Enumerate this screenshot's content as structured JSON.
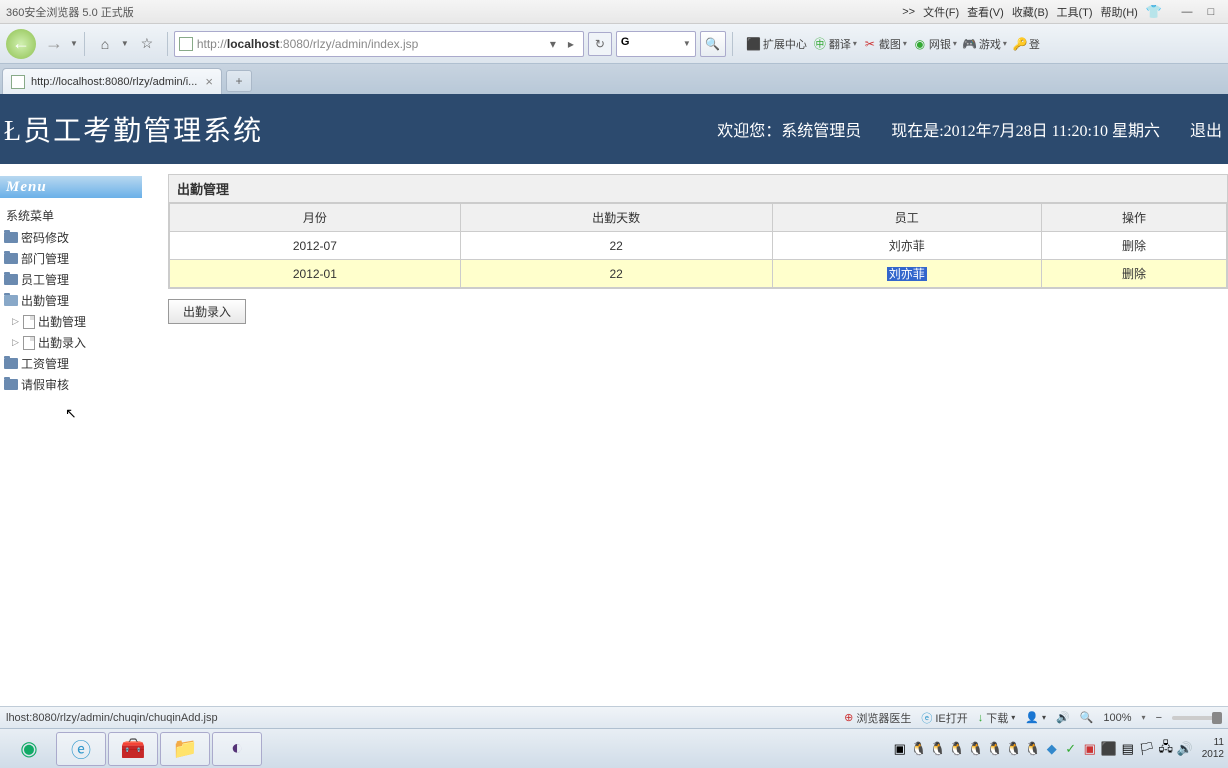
{
  "titlebar": {
    "title": "360安全浏览器 5.0 正式版",
    "menus": [
      "文件(F)",
      "查看(V)",
      "收藏(B)",
      "工具(T)",
      "帮助(H)"
    ],
    "chevron": ">>"
  },
  "navbar": {
    "url_prefix": "http://",
    "url_host": "localhost",
    "url_rest": ":8080/rlzy/admin/index.jsp",
    "extensions": [
      "扩展中心",
      "翻译",
      "截图",
      "网银",
      "游戏",
      "登"
    ]
  },
  "tabs": {
    "active": "http://localhost:8080/rlzy/admin/i..."
  },
  "header": {
    "title": "Ł员工考勤管理系统",
    "welcome": "欢迎您：系统管理员",
    "now": "现在是:2012年7月28日  11:20:10 星期六",
    "logout": "退出"
  },
  "sidebar": {
    "menu_label": "Menu",
    "section": "系统菜单",
    "items": [
      "密码修改",
      "部门管理",
      "员工管理",
      "出勤管理"
    ],
    "children": [
      "出勤管理",
      "出勤录入"
    ],
    "items2": [
      "工资管理",
      "请假审核"
    ]
  },
  "content": {
    "panel_title": "出勤管理",
    "headers": [
      "月份",
      "出勤天数",
      "员工",
      "操作"
    ],
    "rows": [
      {
        "month": "2012-07",
        "days": "22",
        "emp": "刘亦菲",
        "action": "删除"
      },
      {
        "month": "2012-01",
        "days": "22",
        "emp": "刘亦菲",
        "action": "删除"
      }
    ],
    "button": "出勤录入"
  },
  "status": {
    "url": "lhost:8080/rlzy/admin/chuqin/chuqinAdd.jsp",
    "doctor": "浏览器医生",
    "ie": "IE打开",
    "download": "下载",
    "zoom": "100%"
  },
  "clock": {
    "line1": "11",
    "line2": "2012"
  }
}
